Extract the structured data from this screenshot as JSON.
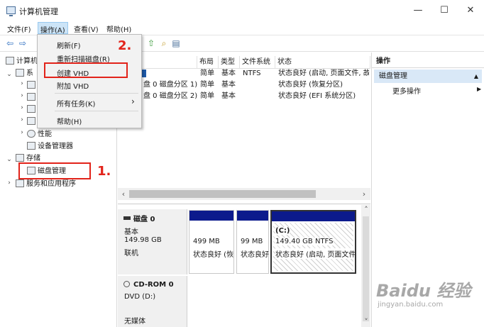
{
  "window": {
    "title": "计算机管理",
    "controls": {
      "minimize": "—",
      "maximize": "☐",
      "close": "✕"
    }
  },
  "menubar": {
    "items": [
      "文件(F)",
      "操作(A)",
      "查看(V)",
      "帮助(H)"
    ],
    "active_index": 1
  },
  "dropdown": {
    "items": [
      {
        "label": "刷新(F)"
      },
      {
        "label": "重新扫描磁盘(R)"
      },
      {
        "label": "创建 VHD"
      },
      {
        "label": "附加 VHD"
      },
      {
        "label": "所有任务(K)",
        "arrow": "›"
      },
      {
        "label": "帮助(H)"
      }
    ]
  },
  "tree": {
    "root": "计算机",
    "system_short": "系",
    "items": {
      "perf": "性能",
      "devmgr": "设备管理器",
      "storage": "存储",
      "diskmgmt": "磁盘管理",
      "services": "服务和应用程序"
    }
  },
  "volume_list": {
    "headers": [
      "布局",
      "类型",
      "文件系统",
      "状态"
    ],
    "rows": [
      {
        "name": "",
        "layout": "简单",
        "type": "基本",
        "fs": "NTFS",
        "status": "状态良好 (启动, 页面文件, 故"
      },
      {
        "name": "盘 0 磁盘分区 1)",
        "layout": "简单",
        "type": "基本",
        "fs": "",
        "status": "状态良好 (恢复分区)"
      },
      {
        "name": "盘 0 磁盘分区 2)",
        "layout": "简单",
        "type": "基本",
        "fs": "",
        "status": "状态良好 (EFI 系统分区)"
      }
    ]
  },
  "disks": [
    {
      "name": "磁盘 0",
      "kind": "基本",
      "size": "149.98 GB",
      "state": "联机",
      "partitions": [
        {
          "label": "",
          "size": "499 MB",
          "status": "状态良好 (恢"
        },
        {
          "label": "",
          "size": "99 MB",
          "status": "状态良好"
        },
        {
          "label": "(C:)",
          "size": "149.40 GB NTFS",
          "status": "状态良好 (启动, 页面文件"
        }
      ]
    },
    {
      "name": "CD-ROM 0",
      "kind": "DVD (D:)",
      "state": "无媒体"
    }
  ],
  "actions": {
    "header": "操作",
    "selected": "磁盘管理",
    "selected_arrow": "▲",
    "more": "更多操作",
    "more_arrow": "▶"
  },
  "annotations": {
    "step1": "1.",
    "step2": "2."
  },
  "watermark": {
    "brand": "Baidu 经验",
    "url": "jingyan.baidu.com"
  },
  "colors": {
    "annotation_red": "#e2231a",
    "partition_header": "#0c1a8c",
    "selection_blue": "#d9e8f7"
  },
  "scroll_arrows": {
    "left": "‹",
    "right": "›",
    "up": "˄",
    "down": "˅"
  }
}
